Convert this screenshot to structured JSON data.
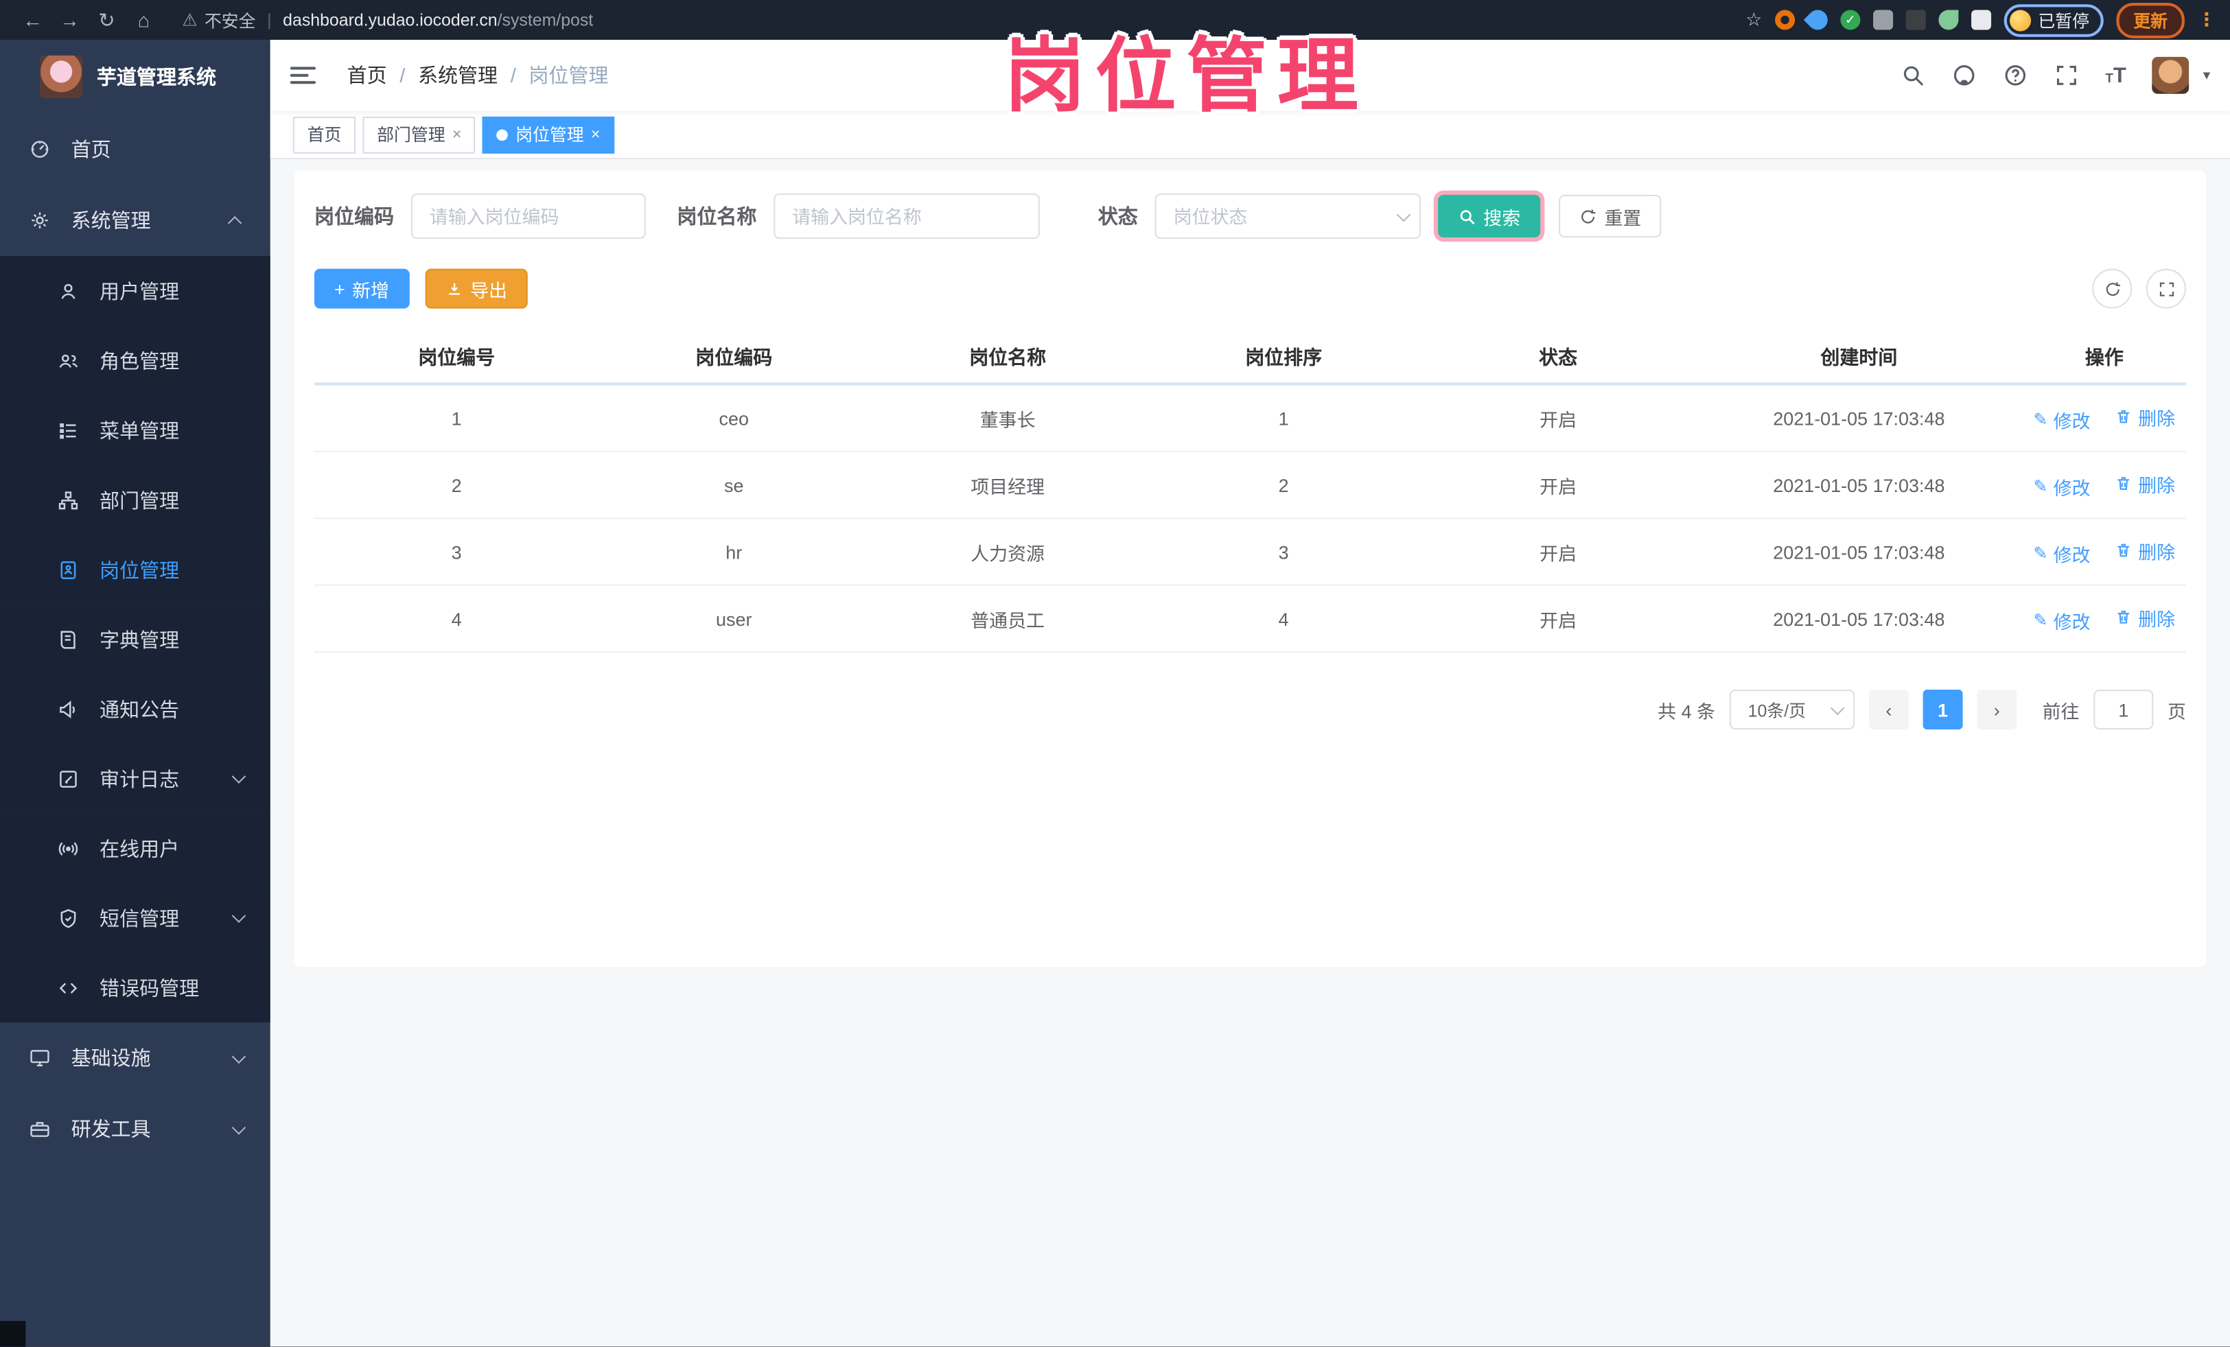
{
  "browser": {
    "security_label": "不安全",
    "url_host": "dashboard.yudao.iocoder.cn",
    "url_path": "/system/post",
    "profile_status": "已暂停",
    "update_label": "更新"
  },
  "annotation": {
    "watermark_text": "岗位管理"
  },
  "sidebar": {
    "logo_title": "芋道管理系统",
    "items": [
      {
        "label": "首页",
        "icon": "gauge-icon",
        "level": "root",
        "chevron": "none",
        "active": false
      },
      {
        "label": "系统管理",
        "icon": "gear-icon",
        "level": "root",
        "chevron": "up",
        "active": false
      },
      {
        "label": "用户管理",
        "icon": "user-icon",
        "level": "sub",
        "chevron": "none",
        "active": false
      },
      {
        "label": "角色管理",
        "icon": "users-icon",
        "level": "sub",
        "chevron": "none",
        "active": false
      },
      {
        "label": "菜单管理",
        "icon": "list-icon",
        "level": "sub",
        "chevron": "none",
        "active": false
      },
      {
        "label": "部门管理",
        "icon": "org-tree-icon",
        "level": "sub",
        "chevron": "none",
        "active": false
      },
      {
        "label": "岗位管理",
        "icon": "badge-icon",
        "level": "sub",
        "chevron": "none",
        "active": true
      },
      {
        "label": "字典管理",
        "icon": "book-icon",
        "level": "sub",
        "chevron": "none",
        "active": false
      },
      {
        "label": "通知公告",
        "icon": "megaphone-icon",
        "level": "sub",
        "chevron": "none",
        "active": false
      },
      {
        "label": "审计日志",
        "icon": "edit-square-icon",
        "level": "sub",
        "chevron": "down",
        "active": false
      },
      {
        "label": "在线用户",
        "icon": "broadcast-icon",
        "level": "sub",
        "chevron": "none",
        "active": false
      },
      {
        "label": "短信管理",
        "icon": "shield-icon",
        "level": "sub",
        "chevron": "down",
        "active": false
      },
      {
        "label": "错误码管理",
        "icon": "code-icon",
        "level": "sub",
        "chevron": "none",
        "active": false
      },
      {
        "label": "基础设施",
        "icon": "monitor-icon",
        "level": "root",
        "chevron": "down",
        "active": false
      },
      {
        "label": "研发工具",
        "icon": "toolbox-icon",
        "level": "root",
        "chevron": "down",
        "active": false
      }
    ]
  },
  "header": {
    "breadcrumb": [
      "首页",
      "系统管理",
      "岗位管理"
    ],
    "breadcrumb_separator": "/",
    "tabs": [
      {
        "label": "首页",
        "closable": false,
        "active": false
      },
      {
        "label": "部门管理",
        "closable": true,
        "active": false
      },
      {
        "label": "岗位管理",
        "closable": true,
        "active": true
      }
    ]
  },
  "search_form": {
    "code_label": "岗位编码",
    "code_placeholder": "请输入岗位编码",
    "name_label": "岗位名称",
    "name_placeholder": "请输入岗位名称",
    "status_label": "状态",
    "status_placeholder": "岗位状态",
    "search_label": "搜索",
    "reset_label": "重置"
  },
  "toolbar": {
    "add_label": "新增",
    "export_label": "导出"
  },
  "table": {
    "headers": [
      "岗位编号",
      "岗位编码",
      "岗位名称",
      "岗位排序",
      "状态",
      "创建时间",
      "操作"
    ],
    "edit_label": "修改",
    "delete_label": "删除",
    "rows": [
      {
        "id": "1",
        "code": "ceo",
        "name": "董事长",
        "sort": "1",
        "status": "开启",
        "created": "2021-01-05 17:03:48"
      },
      {
        "id": "2",
        "code": "se",
        "name": "项目经理",
        "sort": "2",
        "status": "开启",
        "created": "2021-01-05 17:03:48"
      },
      {
        "id": "3",
        "code": "hr",
        "name": "人力资源",
        "sort": "3",
        "status": "开启",
        "created": "2021-01-05 17:03:48"
      },
      {
        "id": "4",
        "code": "user",
        "name": "普通员工",
        "sort": "4",
        "status": "开启",
        "created": "2021-01-05 17:03:48"
      }
    ]
  },
  "pagination": {
    "total_label": "共 4 条",
    "page_size_label": "10条/页",
    "current_page": "1",
    "goto_label": "前往",
    "goto_value": "1",
    "page_suffix": "页"
  },
  "icons_glyphs": {
    "back": "←",
    "forward": "→",
    "reload": "↻",
    "home": "⌂",
    "warning": "⚠",
    "star": "☆",
    "kebab": "⋮",
    "caret": "▾",
    "check": "✓",
    "pencil": "✎",
    "plus": "+",
    "prev": "‹",
    "next": "›"
  },
  "colors": {
    "primary": "#409eff",
    "search_button": "#2bb9a3",
    "export_button": "#efa030",
    "watermark": "#f4446e",
    "active_tab": "#409eff"
  }
}
